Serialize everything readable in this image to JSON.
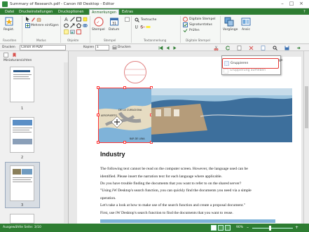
{
  "window": {
    "title": "Summary of Research.pdf - Canon iW Desktop - Editor",
    "minimize_glyph": "–",
    "maximize_glyph": "□",
    "close_glyph": "×"
  },
  "menu": {
    "tabs": [
      "Datei",
      "Druckeinstellungen",
      "Druckoptionen",
      "Anmerkungen",
      "Extras"
    ],
    "active_tab": "Anmerkungen",
    "help_glyph": "?"
  },
  "ribbon": {
    "register_label": "Regist.",
    "multi_insert_label": "Mehrere einfügen",
    "stamp_label": "Stempel",
    "date_label": "Datum",
    "text_search_label": "Textsuche",
    "digital_stamp_label": "Digitale Stempel",
    "signature_status_label": "Signaturstatus",
    "check_label": "Prüfen",
    "order_label": "Vorgänge",
    "view_label": "Ansic",
    "groups": [
      "Favoriten",
      "Modus",
      "Objekte",
      "Stempel",
      "Textanmerkung",
      "Digitale Stempel"
    ]
  },
  "toolbar": {
    "print_label": "Drucken",
    "printer_value": "Canon iR-ADV",
    "copies_label": "Kopien",
    "copies_value": "1",
    "print2_label": "Drucken"
  },
  "sidepane": {
    "title": "Miniaturansichten",
    "pages": [
      "1",
      "2",
      "3"
    ]
  },
  "dropdown": {
    "row_label": "Reihe",
    "page_orientation_label": "Seitenvorgänge",
    "group_label": "Gruppe",
    "grouping_label": "Gruppieren",
    "ungroup_label": "Gruppierung aufheben"
  },
  "document": {
    "heading": "Industry",
    "lines": [
      "The following text cannot be read on the computer screen. However, the language used can be",
      "identified. Please insert the narration text for each language where applicable.",
      "Do you have trouble finding the documents that you want to refer to on the shared server?",
      "\"Using iW Desktop's search function, you can quickly find the documents you need via a simple",
      "operation.",
      "Let's take a look at how to make use of the search function and create a proposal document.\"",
      "First, use iW Desktop's search function to find the documents that you want to reuse."
    ],
    "map_labels": [
      "DE LA CURACIONA",
      "AEROPUERTO",
      "BAR DE LUNA"
    ]
  },
  "status": {
    "selected_page": "Ausgewählte Seite: 3/10",
    "zoom": "90%"
  }
}
